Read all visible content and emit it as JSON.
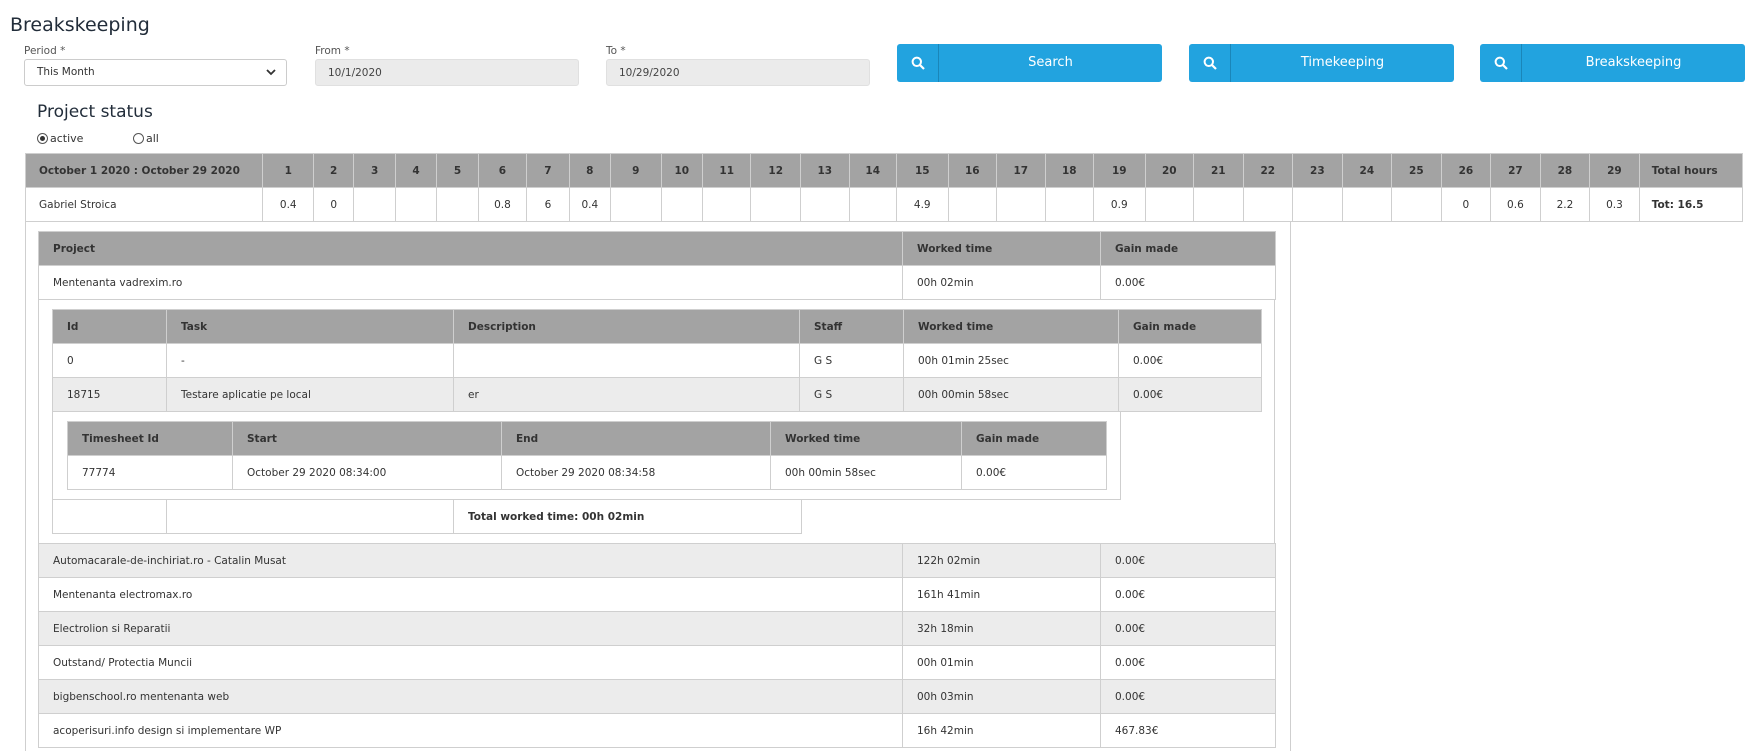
{
  "page": {
    "title": "Breakskeeping"
  },
  "filters": {
    "period_label": "Period *",
    "period_value": "This Month",
    "from_label": "From *",
    "from_value": "10/1/2020",
    "to_label": "To *",
    "to_value": "10/29/2020"
  },
  "buttons": {
    "search": "Search",
    "timekeeping": "Timekeeping",
    "breakskeeping": "Breakskeeping"
  },
  "project_status": {
    "title": "Project status",
    "radio_active": "active",
    "radio_all": "all",
    "selected": "active"
  },
  "days_table": {
    "range_header": "October 1 2020 : October 29 2020",
    "days": [
      "1",
      "2",
      "3",
      "4",
      "5",
      "6",
      "7",
      "8",
      "9",
      "10",
      "11",
      "12",
      "13",
      "14",
      "15",
      "16",
      "17",
      "18",
      "19",
      "20",
      "21",
      "22",
      "23",
      "24",
      "25",
      "26",
      "27",
      "28",
      "29"
    ],
    "total_header": "Total hours",
    "row": {
      "name": "Gabriel Stroica",
      "values": [
        "0.4",
        "0",
        "",
        "",
        "",
        "0.8",
        "6",
        "0.4",
        "",
        "",
        "",
        "",
        "",
        "",
        "4.9",
        "",
        "",
        "",
        "0.9",
        "",
        "",
        "",
        "",
        "",
        "",
        "0",
        "0.6",
        "2.2",
        "0.3"
      ],
      "total": "Tot: 16.5"
    }
  },
  "projects_table": {
    "headers": {
      "project": "Project",
      "worked_time": "Worked time",
      "gain": "Gain made"
    },
    "first": {
      "project": "Mentenanta vadrexim.ro",
      "worked_time": "00h 02min",
      "gain": "0.00€"
    },
    "rest": [
      {
        "project": "Automacarale-de-inchiriat.ro - Catalin Musat",
        "worked_time": "122h 02min",
        "gain": "0.00€"
      },
      {
        "project": "Mentenanta electromax.ro",
        "worked_time": "161h 41min",
        "gain": "0.00€"
      },
      {
        "project": "Electrolion si Reparatii",
        "worked_time": "32h 18min",
        "gain": "0.00€"
      },
      {
        "project": "Outstand/ Protectia Muncii",
        "worked_time": "00h 01min",
        "gain": "0.00€"
      },
      {
        "project": "bigbenschool.ro mentenanta web",
        "worked_time": "00h 03min",
        "gain": "0.00€"
      },
      {
        "project": "acoperisuri.info design si implementare WP",
        "worked_time": "16h 42min",
        "gain": "467.83€"
      }
    ]
  },
  "tasks_table": {
    "headers": {
      "id": "Id",
      "task": "Task",
      "description": "Description",
      "staff": "Staff",
      "worked_time": "Worked time",
      "gain": "Gain made"
    },
    "rows": [
      {
        "id": "0",
        "task": "-",
        "description": "",
        "staff": "G S",
        "worked_time": "00h 01min 25sec",
        "gain": "0.00€"
      },
      {
        "id": "18715",
        "task": "Testare aplicatie pe local",
        "description": "er",
        "staff": "G S",
        "worked_time": "00h 00min 58sec",
        "gain": "0.00€"
      }
    ],
    "total_label": "Total worked time: 00h 02min"
  },
  "timesheet_table": {
    "headers": {
      "id": "Timesheet Id",
      "start": "Start",
      "end": "End",
      "worked_time": "Worked time",
      "gain": "Gain made"
    },
    "rows": [
      {
        "id": "77774",
        "start": "October 29 2020 08:34:00",
        "end": "October 29 2020 08:34:58",
        "worked_time": "00h 00min 58sec",
        "gain": "0.00€"
      }
    ]
  }
}
